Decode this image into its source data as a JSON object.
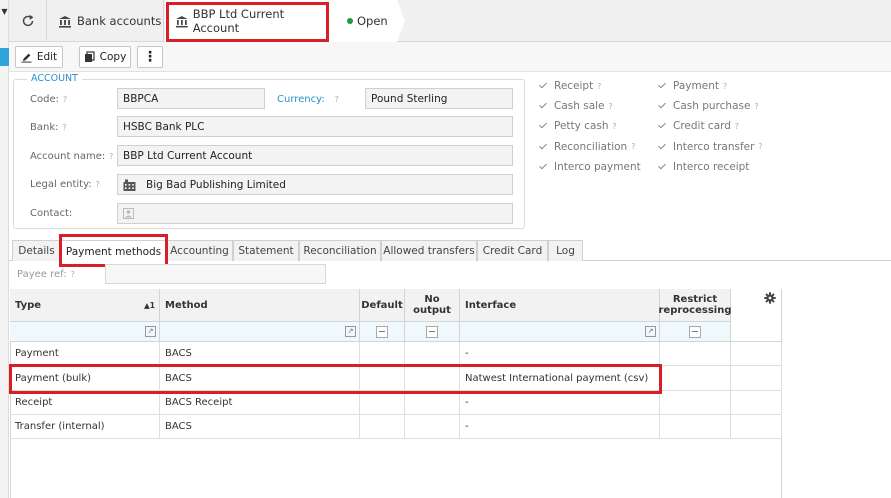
{
  "breadcrumb": {
    "bank_accounts": "Bank accounts",
    "account": "BBP Ltd Current Account",
    "status": "Open"
  },
  "toolbar": {
    "edit": "Edit",
    "copy": "Copy",
    "more": "⋮"
  },
  "account": {
    "legend": "ACCOUNT",
    "code_label": "Code:",
    "code": "BBPCA",
    "currency_label": "Currency:",
    "currency": "Pound Sterling",
    "bank_label": "Bank:",
    "bank": "HSBC Bank PLC",
    "name_label": "Account name:",
    "name": "BBP Ltd Current Account",
    "entity_label": "Legal entity:",
    "entity": "Big Bad Publishing Limited",
    "contact_label": "Contact:",
    "help": "?"
  },
  "flags_left": [
    "Receipt",
    "Cash sale",
    "Petty cash",
    "Reconciliation",
    "Interco payment"
  ],
  "flags_right": [
    "Payment",
    "Cash purchase",
    "Credit card",
    "Interco transfer",
    "Interco receipt"
  ],
  "tabs": [
    "Details",
    "Payment methods",
    "Accounting",
    "Statement",
    "Reconciliation",
    "Allowed transfers",
    "Credit Card",
    "Log"
  ],
  "payee_label": "Payee ref:",
  "grid": {
    "headers": {
      "type": "Type",
      "sort": "▲1",
      "method": "Method",
      "default": "Default",
      "no_output": "No output",
      "interface": "Interface",
      "restrict": "Restrict reprocessing"
    },
    "rows": [
      {
        "type": "Payment",
        "method": "BACS",
        "interface": "-"
      },
      {
        "type": "Payment (bulk)",
        "method": "BACS",
        "interface": "Natwest International payment (csv)"
      },
      {
        "type": "Receipt",
        "method": "BACS Receipt",
        "interface": "-"
      },
      {
        "type": "Transfer (internal)",
        "method": "BACS",
        "interface": "-"
      }
    ]
  }
}
